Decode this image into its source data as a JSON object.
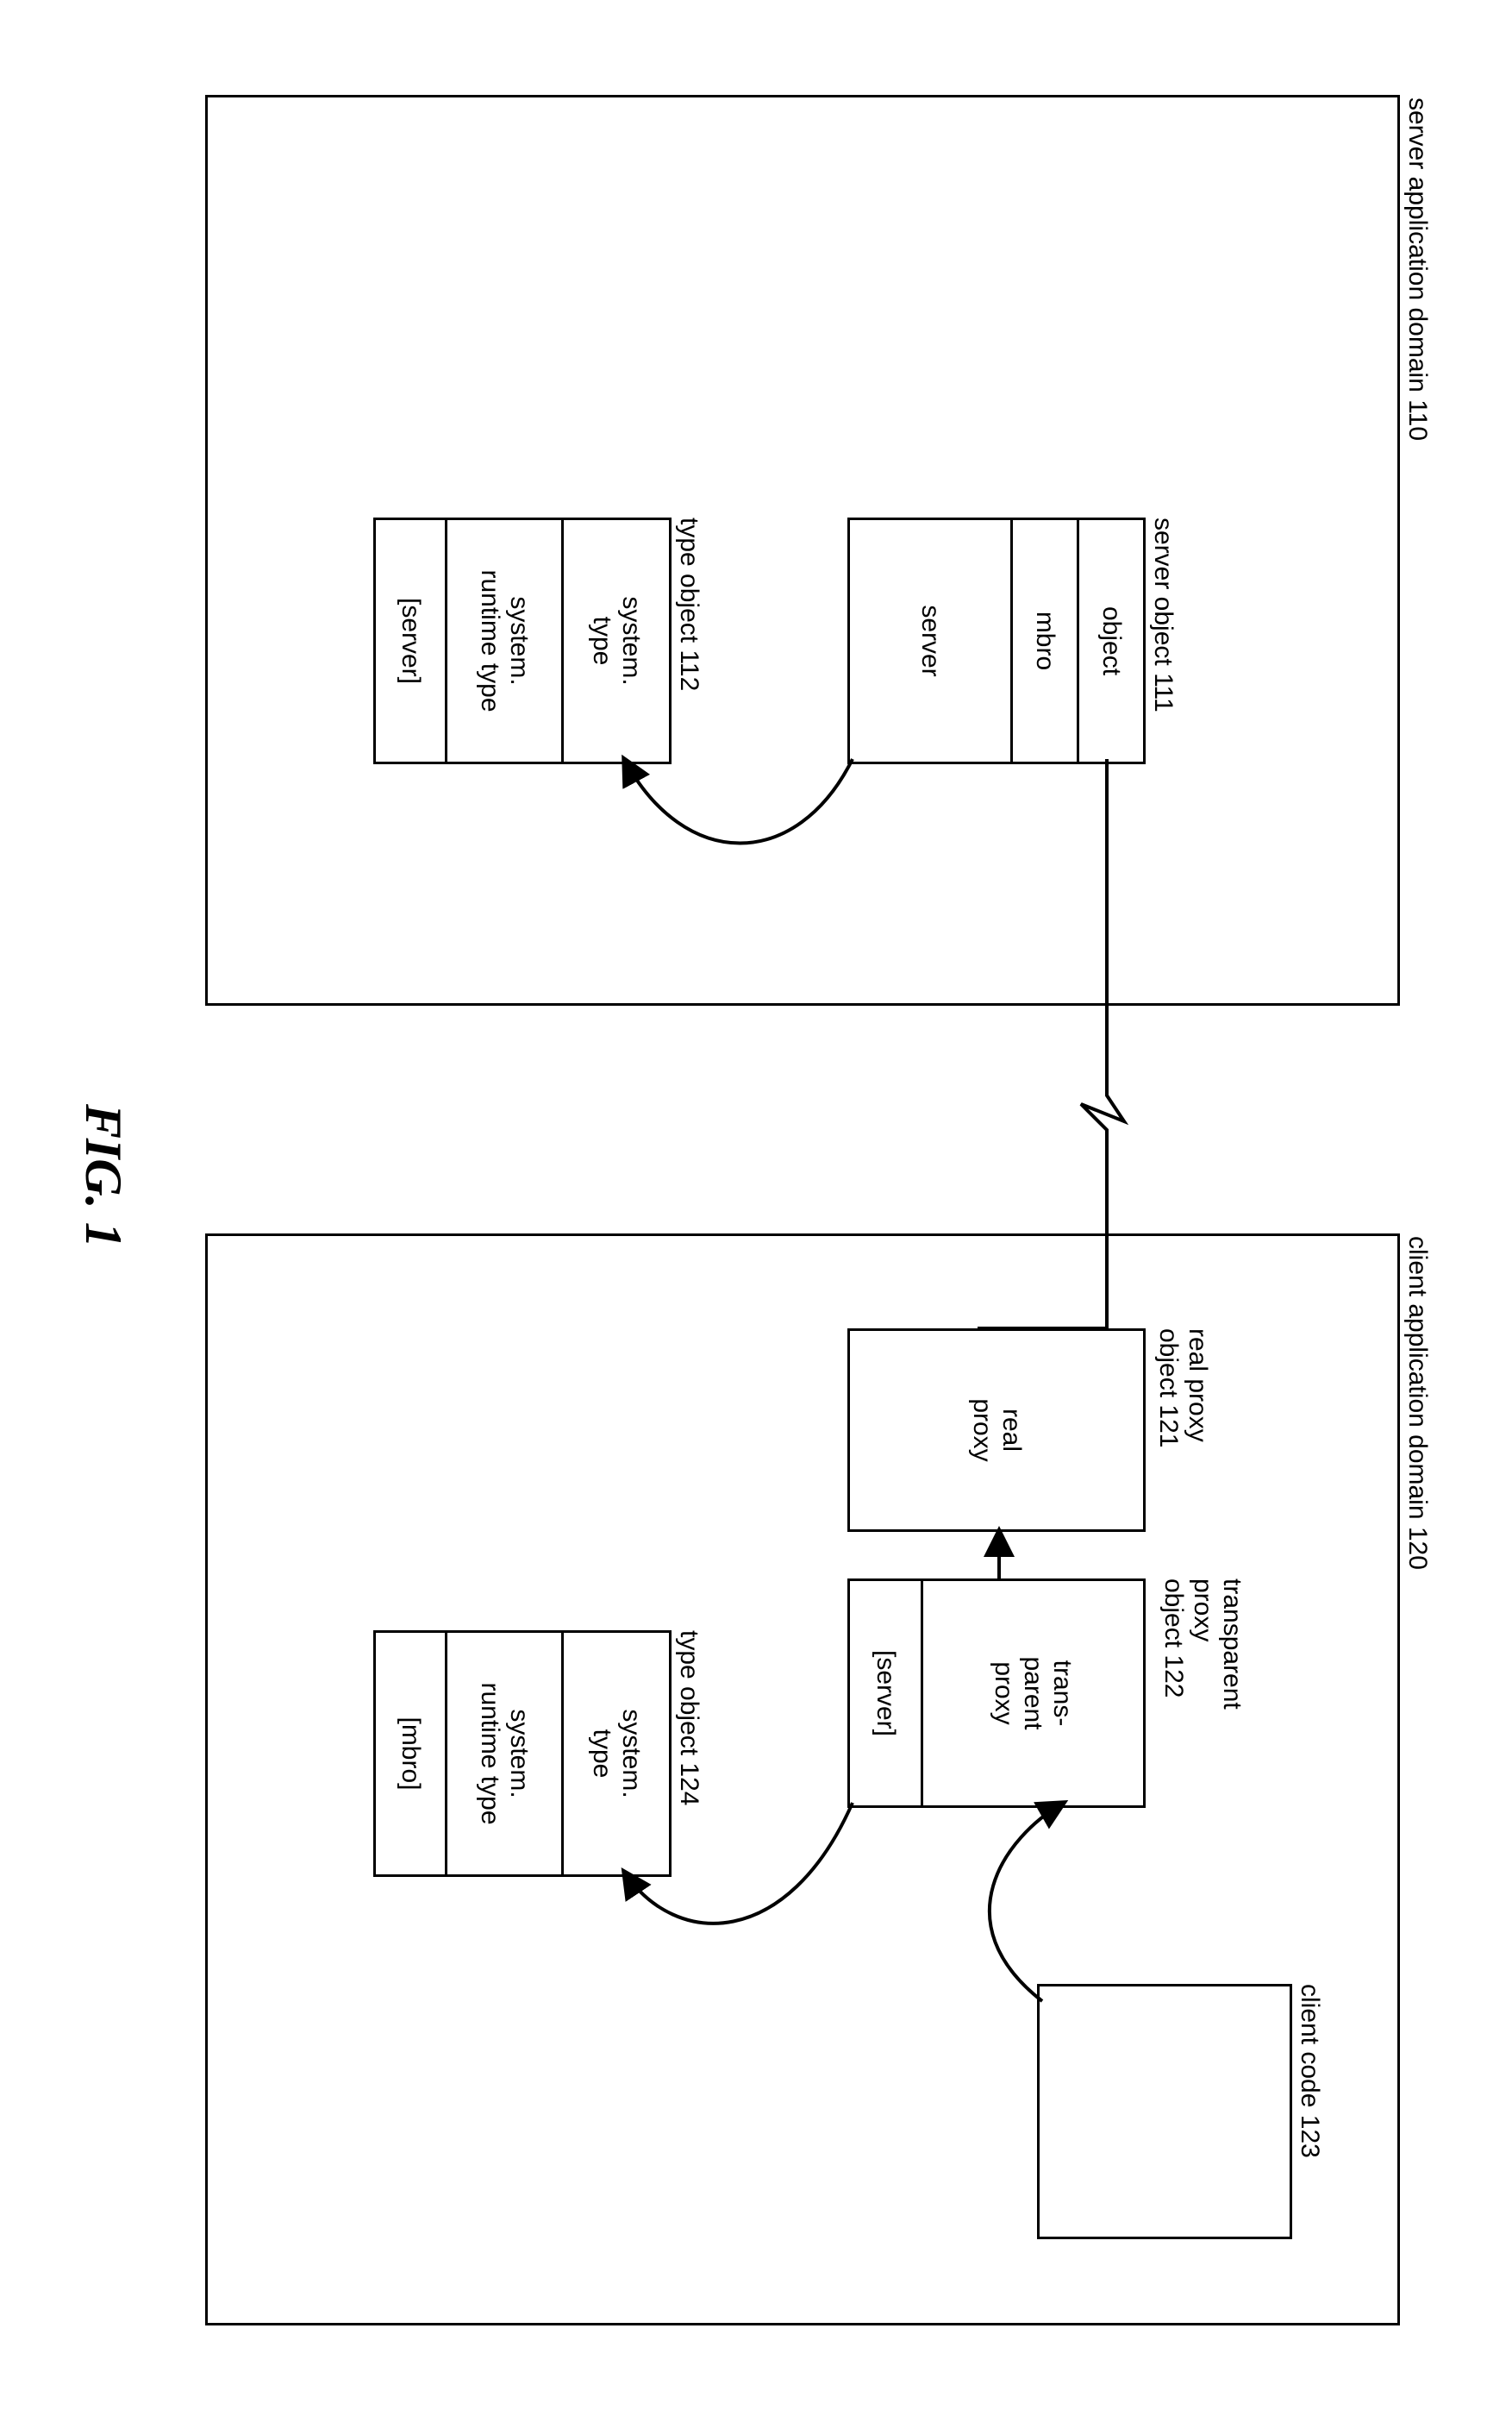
{
  "figure_caption": "FIG. 1",
  "server_domain": {
    "title": "server application domain 110",
    "server_object": {
      "label": "server object 111",
      "rows": [
        "object",
        "mbro",
        "server"
      ]
    },
    "type_object": {
      "label": "type object 112",
      "rows": [
        "system.\ntype",
        "system.\nruntime type",
        "[server]"
      ]
    }
  },
  "client_domain": {
    "title": "client application domain 120",
    "real_proxy": {
      "label": "real proxy\nobject 121",
      "rows": [
        "real\nproxy"
      ]
    },
    "trans_proxy": {
      "label": "transparent\nproxy\nobject 122",
      "rows": [
        "trans-\nparent\nproxy",
        "[server]"
      ]
    },
    "client_code": {
      "label": "client code 123",
      "rows": [
        ""
      ]
    },
    "type_object": {
      "label": "type object 124",
      "rows": [
        "system.\ntype",
        "system.\nruntime type",
        "[mbro]"
      ]
    }
  }
}
